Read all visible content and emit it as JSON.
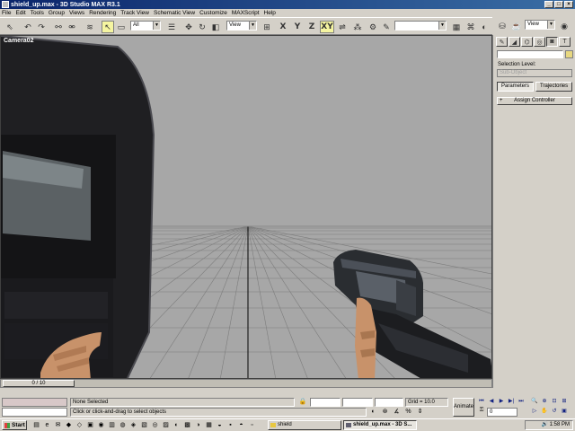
{
  "window": {
    "title": "shield_up.max - 3D Studio MAX R3.1"
  },
  "menu": [
    "File",
    "Edit",
    "Tools",
    "Group",
    "Views",
    "Rendering",
    "Track View",
    "Schematic View",
    "Customize",
    "MAXScript",
    "Help"
  ],
  "toolbar": {
    "selection_filter": "All",
    "ref_coord": "View",
    "axis_x": "X",
    "axis_y": "Y",
    "axis_z": "Z",
    "axis_xy": "XY",
    "named_selection": "",
    "view_dropdown": "View"
  },
  "viewport": {
    "label": "Camera02"
  },
  "command_panel": {
    "selection_level_label": "Selection Level:",
    "sub_object": "Sub-Object",
    "tab_parameters": "Parameters",
    "tab_trajectories": "Trajectories",
    "assign_controller": "Assign Controller",
    "rollout_toggle": "+"
  },
  "timeline": {
    "position": "0 / 10"
  },
  "status": {
    "selection": "None Selected",
    "prompt": "Click or click-and-drag to select objects",
    "grid": "Grid = 10.0",
    "animate": "Animate",
    "frame": "0"
  },
  "taskbar": {
    "start": "Start",
    "tasks": [
      "shield",
      "shield_up.max - 3D S..."
    ],
    "clock": "1:58 PM"
  }
}
